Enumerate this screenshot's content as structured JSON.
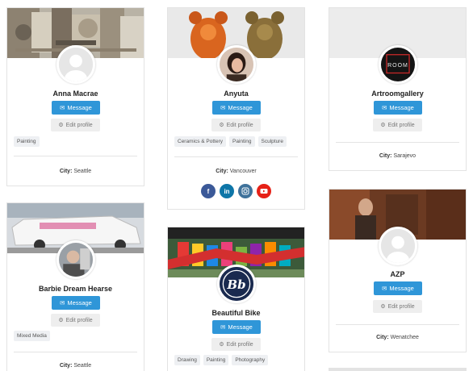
{
  "common": {
    "message_label": "Message",
    "edit_label": "Edit profile",
    "city_label": "City:"
  },
  "cards": [
    {
      "name": "Anna Macrae",
      "tags": [
        "Painting"
      ],
      "city": "Seattle"
    },
    {
      "name": "Anyuta",
      "tags": [
        "Ceramics & Pottery",
        "Painting",
        "Sculpture"
      ],
      "city": "Vancouver",
      "social": [
        "f",
        "in",
        "ig",
        "yt"
      ]
    },
    {
      "name": "Artroomgallery",
      "tags": [],
      "city": "Sarajevo",
      "avatar_text": "ROOM"
    },
    {
      "name": "Barbie Dream Hearse",
      "tags": [
        "Mixed Media"
      ],
      "city": "Seattle"
    },
    {
      "name": "Beautiful Bike",
      "tags": [
        "Drawing",
        "Painting",
        "Photography"
      ],
      "avatar_text": "Bb"
    },
    {
      "name": "AZP",
      "tags": [],
      "city": "Wenatchee"
    }
  ],
  "colors": {
    "message_button": "#2f96d8",
    "facebook": "#3b5998",
    "linkedin": "#0e76a8",
    "instagram": "#3f729b",
    "youtube": "#e62117"
  }
}
